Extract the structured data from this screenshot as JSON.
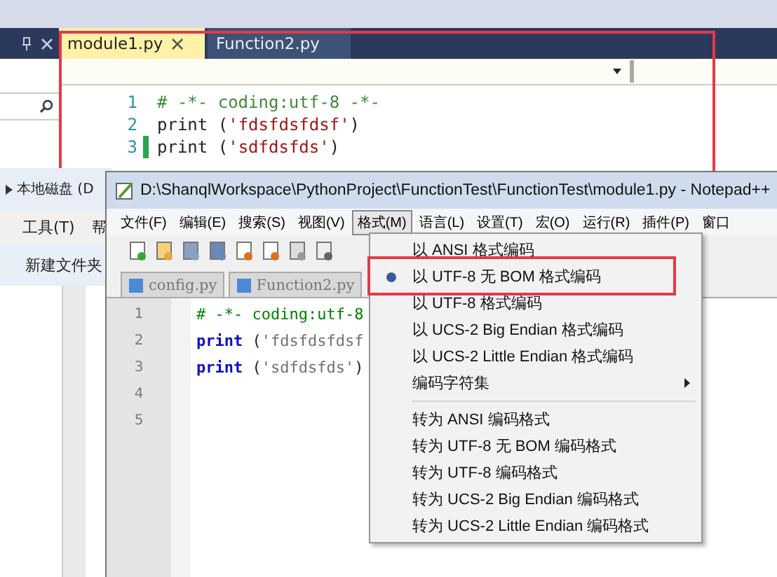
{
  "vs_window": {
    "tabs": [
      {
        "label": "module1.py",
        "selected": true
      },
      {
        "label": "Function2.py",
        "selected": false
      }
    ],
    "code_lines": [
      {
        "number": "1",
        "changed": false,
        "segments": [
          {
            "kind": "comment",
            "text": "# -*- coding:utf-8 -*-"
          }
        ]
      },
      {
        "number": "2",
        "changed": false,
        "segments": [
          {
            "kind": "keyword",
            "text": "print "
          },
          {
            "kind": "plain",
            "text": "("
          },
          {
            "kind": "string",
            "text": "'fdsfdsfdsf'"
          },
          {
            "kind": "plain",
            "text": ")"
          }
        ]
      },
      {
        "number": "3",
        "changed": true,
        "segments": [
          {
            "kind": "keyword",
            "text": "print "
          },
          {
            "kind": "plain",
            "text": "("
          },
          {
            "kind": "string",
            "text": "'sdfdsfds'"
          },
          {
            "kind": "plain",
            "text": ")"
          }
        ]
      }
    ]
  },
  "explorer_window": {
    "breadcrumb": "本地磁盘 (D",
    "menu": [
      "工具(T)",
      "帮"
    ],
    "toolbar_button": "新建文件夹"
  },
  "notepad_window": {
    "title": "D:\\ShanqlWorkspace\\PythonProject\\FunctionTest\\FunctionTest\\module1.py - Notepad++",
    "menu": [
      {
        "label": "文件(F)",
        "selected": false
      },
      {
        "label": "编辑(E)",
        "selected": false
      },
      {
        "label": "搜索(S)",
        "selected": false
      },
      {
        "label": "视图(V)",
        "selected": false
      },
      {
        "label": "格式(M)",
        "selected": true
      },
      {
        "label": "语言(L)",
        "selected": false
      },
      {
        "label": "设置(T)",
        "selected": false
      },
      {
        "label": "宏(O)",
        "selected": false
      },
      {
        "label": "运行(R)",
        "selected": false
      },
      {
        "label": "插件(P)",
        "selected": false
      },
      {
        "label": "窗口",
        "selected": false
      }
    ],
    "tabs": [
      {
        "label": "config.py",
        "selected": false
      },
      {
        "label": "Function2.py",
        "selected": false
      }
    ],
    "line_numbers": [
      "1",
      "2",
      "3",
      "4",
      "5"
    ],
    "code_lines": [
      {
        "segments": [
          {
            "kind": "comment",
            "text": "# -*- coding:utf-8"
          }
        ]
      },
      {
        "segments": [
          {
            "kind": "keyword",
            "text": "print"
          },
          {
            "kind": "plain",
            "text": " ("
          },
          {
            "kind": "string",
            "text": "'fdsfdsfdsf"
          }
        ]
      },
      {
        "segments": [
          {
            "kind": "keyword",
            "text": "print"
          },
          {
            "kind": "plain",
            "text": " ("
          },
          {
            "kind": "string",
            "text": "'sdfdsfds'"
          },
          {
            "kind": "plain",
            "text": ")"
          }
        ]
      }
    ]
  },
  "format_menu": {
    "items": [
      {
        "kind": "item",
        "label": "以 ANSI 格式编码",
        "checked": false
      },
      {
        "kind": "item",
        "label": "以 UTF-8 无 BOM 格式编码",
        "checked": true
      },
      {
        "kind": "item",
        "label": "以 UTF-8 格式编码",
        "checked": false
      },
      {
        "kind": "item",
        "label": "以 UCS-2 Big Endian 格式编码",
        "checked": false
      },
      {
        "kind": "item",
        "label": "以 UCS-2 Little Endian 格式编码",
        "checked": false
      },
      {
        "kind": "submenu",
        "label": "编码字符集"
      },
      {
        "kind": "separator"
      },
      {
        "kind": "item",
        "label": "转为 ANSI 编码格式",
        "checked": false
      },
      {
        "kind": "item",
        "label": "转为 UTF-8 无 BOM 编码格式",
        "checked": false
      },
      {
        "kind": "item",
        "label": "转为 UTF-8 编码格式",
        "checked": false
      },
      {
        "kind": "item",
        "label": "转为 UCS-2 Big Endian 编码格式",
        "checked": false
      },
      {
        "kind": "item",
        "label": "转为 UCS-2 Little Endian 编码格式",
        "checked": false
      }
    ]
  }
}
